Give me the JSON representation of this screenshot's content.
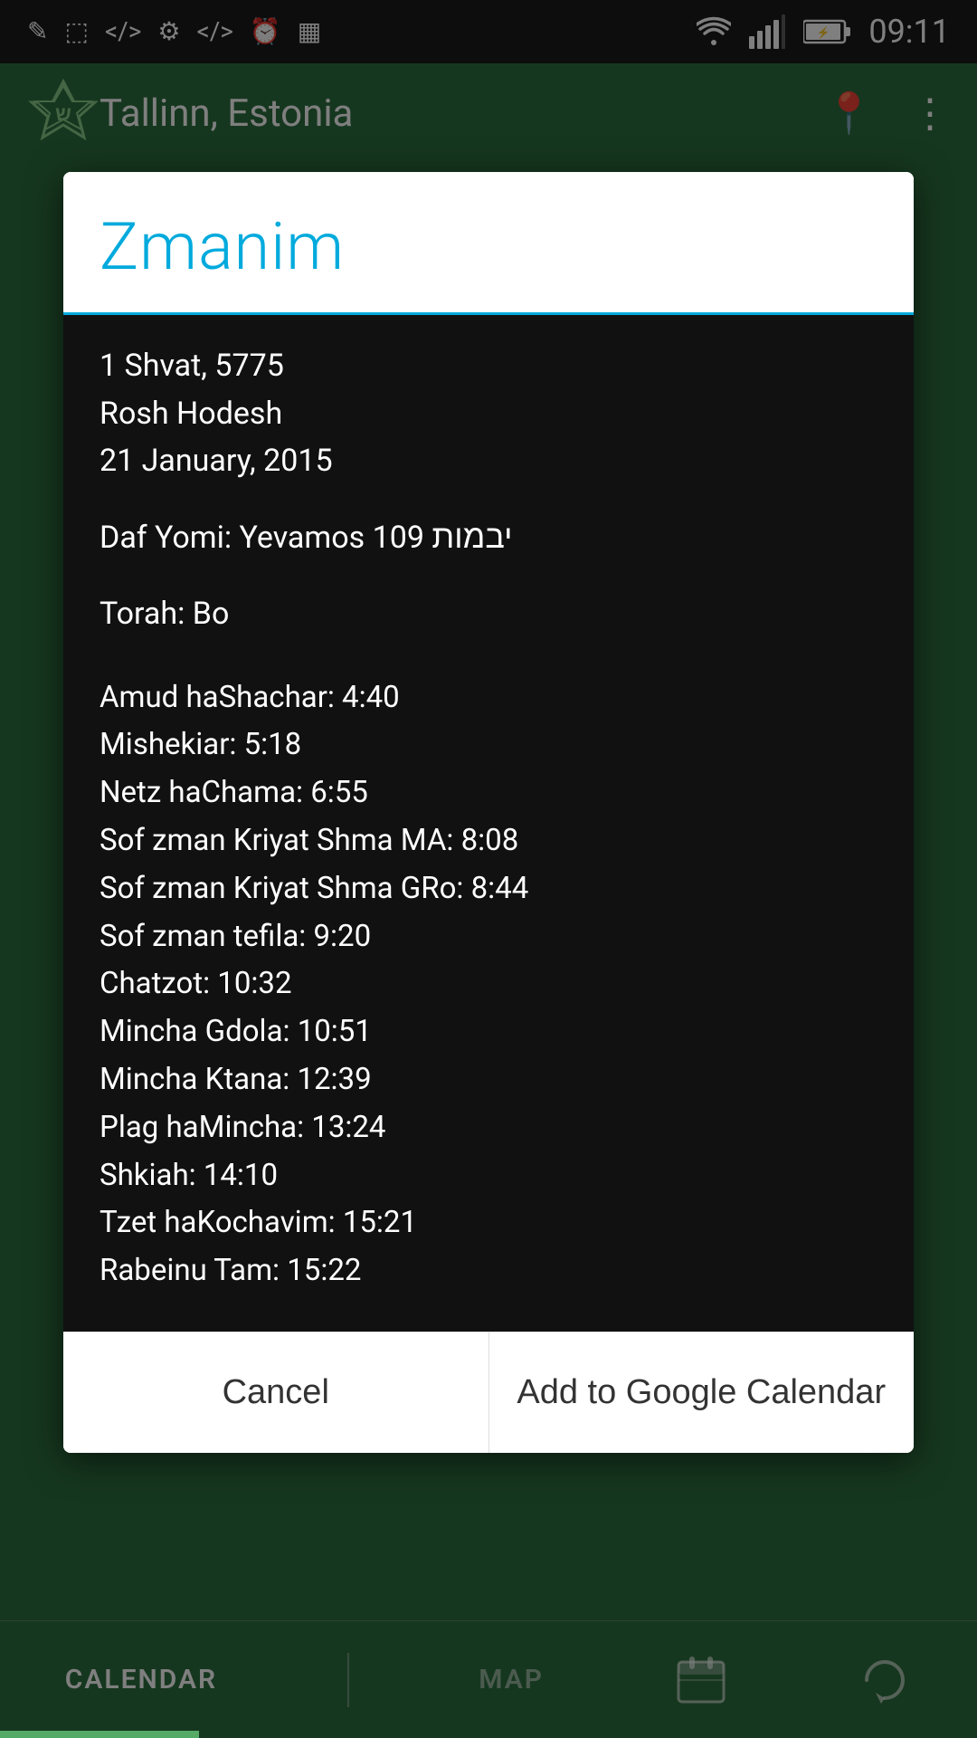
{
  "statusBar": {
    "time": "09:11",
    "icons": [
      "✎",
      "▣",
      "<>",
      "⚡",
      "<>",
      "⏰",
      "▦"
    ]
  },
  "header": {
    "title": "Tallinn, Estonia",
    "locationIcon": "📍",
    "menuIcon": "⋮"
  },
  "dialog": {
    "title": "Zmanim",
    "dateLines": [
      "1 Shvat, 5775",
      "Rosh Hodesh",
      "21 January, 2015"
    ],
    "dafYomi": "Daf Yomi: Yevamos 109",
    "dafYomiHebrew": "יבמות",
    "torah": "Torah: Bo",
    "times": [
      "Amud haShachar: 4:40",
      "Mishekiar: 5:18",
      "Netz haChama: 6:55",
      "Sof zman Kriyat Shma MA: 8:08",
      "Sof zman Kriyat Shma GRo: 8:44",
      "Sof zman tefila: 9:20",
      "Chatzot: 10:32",
      "Mincha Gdola: 10:51",
      "Mincha Ktana: 12:39",
      "Plag haMincha: 13:24",
      "Shkiah: 14:10",
      "Tzet haKochavim: 15:21",
      "Rabeinu Tam: 15:22"
    ],
    "buttons": {
      "cancel": "Cancel",
      "addToCalendar": "Add to Google Calendar"
    }
  },
  "bottomNav": {
    "items": [
      {
        "label": "CALENDAR",
        "active": true
      },
      {
        "label": "MAP",
        "active": false
      }
    ],
    "icons": [
      "📅",
      "🔄"
    ]
  }
}
